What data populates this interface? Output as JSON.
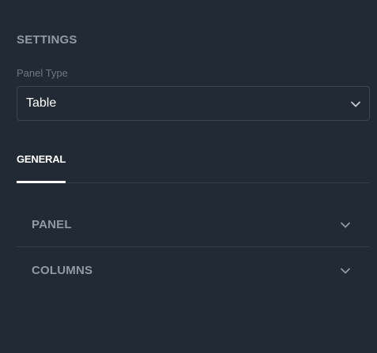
{
  "settings": {
    "heading": "SETTINGS",
    "panel_type": {
      "label": "Panel Type",
      "selected": "Table",
      "icon": "chevron-down-icon"
    }
  },
  "tabs": [
    {
      "label": "GENERAL",
      "active": true
    }
  ],
  "sections": [
    {
      "label": "PANEL",
      "expanded": false,
      "icon": "chevron-down-icon"
    },
    {
      "label": "COLUMNS",
      "expanded": false,
      "icon": "chevron-down-icon"
    }
  ],
  "colors": {
    "background": "#222b35",
    "heading": "#8f9aa6",
    "muted_label": "#6c7884",
    "border": "#3b4652",
    "text": "#ffffff"
  }
}
